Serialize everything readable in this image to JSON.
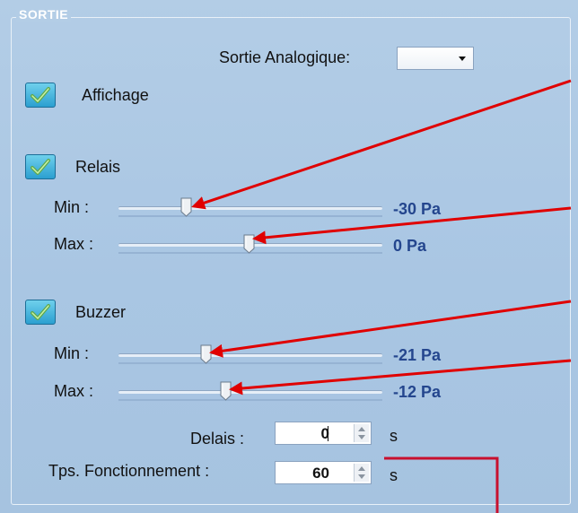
{
  "group": {
    "title": "SORTIE"
  },
  "analog_output": {
    "label": "Sortie Analogique:",
    "selected": ""
  },
  "affichage": {
    "label": "Affichage",
    "checked": true
  },
  "relais": {
    "label": "Relais",
    "checked": true,
    "min_label": "Min :",
    "min_value": "-30 Pa",
    "max_label": "Max :",
    "max_value": "0 Pa"
  },
  "buzzer": {
    "label": "Buzzer",
    "checked": true,
    "min_label": "Min :",
    "min_value": "-21 Pa",
    "max_label": "Max :",
    "max_value": "-12 Pa"
  },
  "delais": {
    "label": "Delais :",
    "value": "0",
    "unit": "s"
  },
  "tps_fonctionnement": {
    "label": "Tps. Fonctionnement :",
    "value": "60",
    "unit": "s"
  },
  "colors": {
    "panel": "#b3cde6",
    "value_text": "#24468e",
    "annotation_arrow": "#e00000"
  }
}
